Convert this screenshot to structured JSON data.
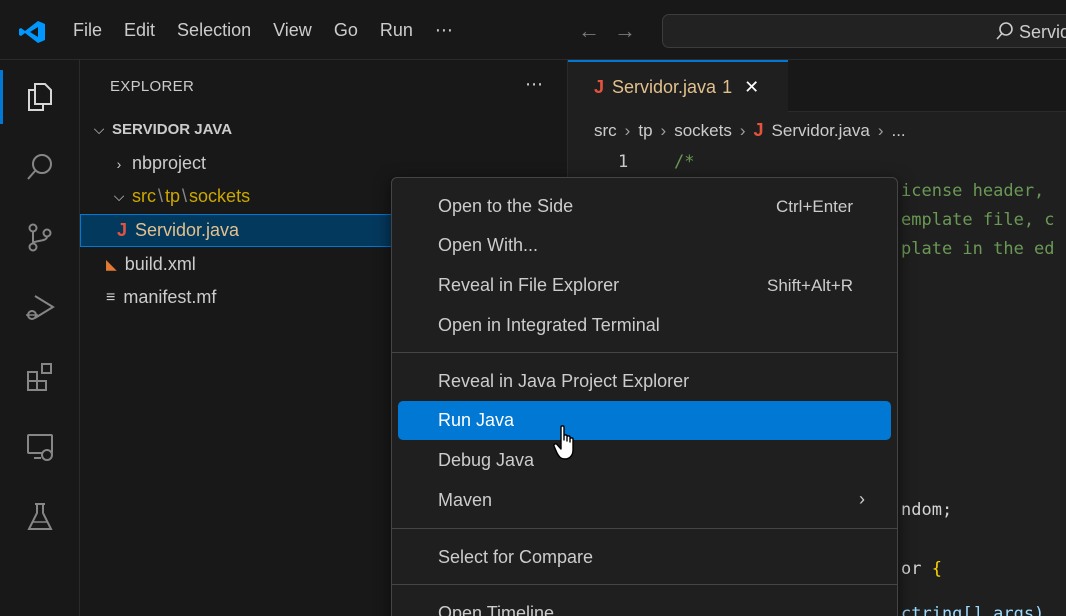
{
  "menubar": {
    "items": [
      "File",
      "Edit",
      "Selection",
      "View",
      "Go",
      "Run",
      "⋯"
    ]
  },
  "nav": {
    "back": "←",
    "forward": "→"
  },
  "search": {
    "text": "Servidor"
  },
  "sidebar": {
    "title": "EXPLORER",
    "more": "⋯",
    "project": "SERVIDOR JAVA",
    "tree": {
      "nbproject": "nbproject",
      "src_folder": {
        "part1": "src",
        "sep1": "\\",
        "part2": "tp",
        "sep2": "\\",
        "part3": "sockets"
      },
      "servidor": "Servidor.java",
      "build": "build.xml",
      "manifest": "manifest.mf"
    }
  },
  "editor": {
    "tab": {
      "name": "Servidor.java",
      "badge": "1",
      "close": "✕"
    },
    "breadcrumb": [
      "src",
      "tp",
      "sockets",
      "Servidor.java",
      "..."
    ],
    "line_number": "1",
    "code": {
      "line1": "/*",
      "line2": "icense header,",
      "line3": "emplate file, c",
      "line4": "plate in the ed",
      "line5": "ndom;",
      "line6_kw": "or",
      "line6_brace": "{",
      "line7": "ctring[] args)"
    }
  },
  "context_menu": {
    "items": [
      {
        "label": "Open to the Side",
        "shortcut": "Ctrl+Enter"
      },
      {
        "label": "Open With..."
      },
      {
        "label": "Reveal in File Explorer",
        "shortcut": "Shift+Alt+R"
      },
      {
        "label": "Open in Integrated Terminal"
      },
      {
        "label": "Reveal in Java Project Explorer"
      },
      {
        "label": "Run Java"
      },
      {
        "label": "Debug Java"
      },
      {
        "label": "Maven"
      },
      {
        "label": "Select for Compare"
      },
      {
        "label": "Open Timeline"
      }
    ]
  },
  "colors": {
    "accent": "#0078d4",
    "folder": "#cca700",
    "java_icon": "#e5533d",
    "modified_file": "#e2c08d",
    "comment": "#6a9955"
  }
}
